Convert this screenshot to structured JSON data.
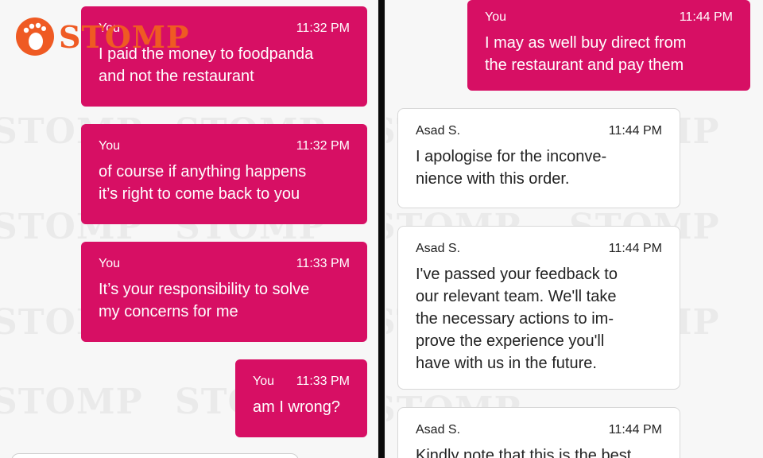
{
  "brand": {
    "logo_text": "STOMP",
    "accent": "#ef5a23",
    "watermark_text": "STOMP"
  },
  "colors": {
    "outgoing": "#d70f64",
    "incoming": "#ffffff",
    "divider": "#0a0a0a"
  },
  "left_panel": {
    "messages": [
      {
        "sender": "You",
        "time": "11:32 PM",
        "text": "I paid the money to foodpanda\nand not the restaurant"
      },
      {
        "sender": "You",
        "time": "11:32 PM",
        "text": "of course if anything happens\nit’s right to come back to you"
      },
      {
        "sender": "You",
        "time": "11:33 PM",
        "text": "It’s your responsibility to solve\nmy concerns for me"
      },
      {
        "sender": "You",
        "time": "11:33 PM",
        "text": "am I wrong?"
      }
    ]
  },
  "right_panel": {
    "messages": [
      {
        "sender": "You",
        "time": "11:44 PM",
        "text": "I may as well buy direct from\nthe restaurant and pay them"
      },
      {
        "sender": "Asad S.",
        "time": "11:44 PM",
        "text": "I apologise for the inconve-\nnience with this order."
      },
      {
        "sender": "Asad S.",
        "time": "11:44 PM",
        "text": "I've passed your feedback to\nour relevant team. We'll take\nthe necessary actions to im-\nprove the experience you'll\nhave with us in the future."
      },
      {
        "sender": "Asad S.",
        "time": "11:44 PM",
        "text": "Kindly note that this is the best"
      }
    ]
  }
}
